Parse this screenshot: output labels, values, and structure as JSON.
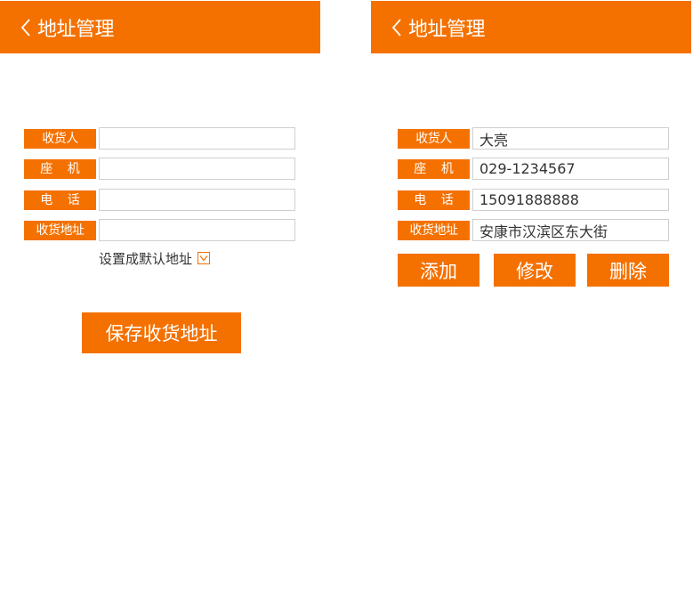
{
  "left": {
    "header": {
      "title": "地址管理"
    },
    "form": {
      "recipient_label": "收货人",
      "landline_label": "座 机",
      "phone_label": "电 话",
      "address_label": "收货地址",
      "recipient_value": "",
      "landline_value": "",
      "phone_value": "",
      "address_value": ""
    },
    "default_label": "设置成默认地址",
    "default_checked": true,
    "save_label": "保存收货地址"
  },
  "right": {
    "header": {
      "title": "地址管理"
    },
    "form": {
      "recipient_label": "收货人",
      "landline_label": "座 机",
      "phone_label": "电 话",
      "address_label": "收货地址",
      "recipient_value": "大亮",
      "landline_value": "029-1234567",
      "phone_value": "15091888888",
      "address_value": "安康市汉滨区东大街"
    },
    "buttons": {
      "add_label": "添加",
      "edit_label": "修改",
      "delete_label": "删除"
    }
  },
  "colors": {
    "accent": "#f47100",
    "border": "#cfcfcf"
  },
  "icons": {
    "back": "chevron-left-icon",
    "check": "check-icon"
  }
}
